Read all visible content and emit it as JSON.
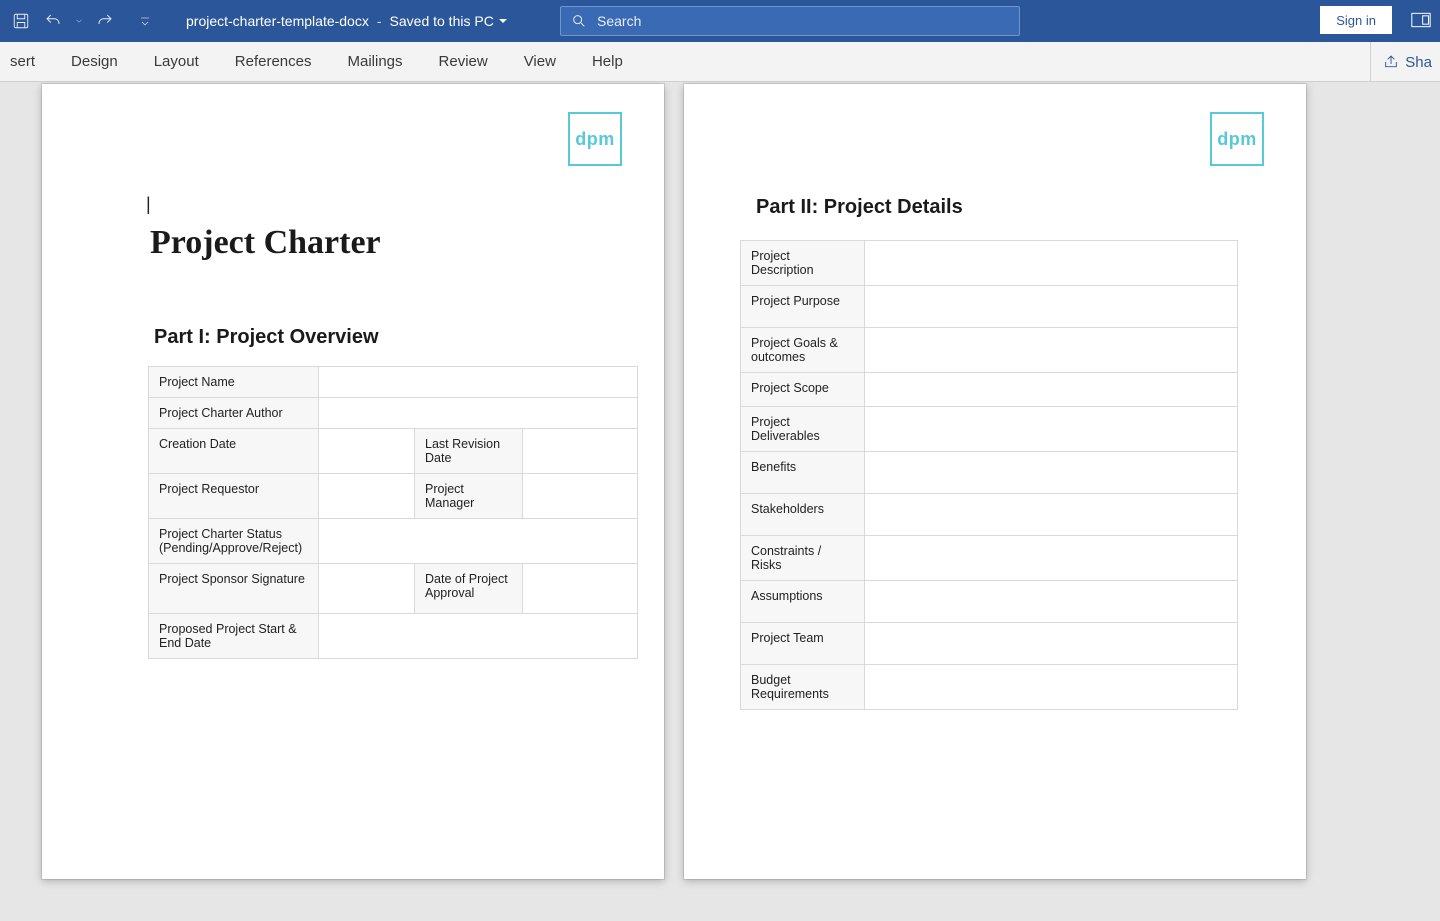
{
  "titlebar": {
    "filename": "project-charter-template-docx",
    "saved_status": "Saved to this PC",
    "search_placeholder": "Search",
    "signin_label": "Sign in"
  },
  "ribbon": {
    "tabs": [
      "sert",
      "Design",
      "Layout",
      "References",
      "Mailings",
      "Review",
      "View",
      "Help"
    ],
    "share_label": "Sha"
  },
  "logo_text": "dpm",
  "page1": {
    "doc_title": "Project Charter",
    "section_title": "Part I: Project Overview",
    "rows": {
      "project_name": "Project Name",
      "charter_author": "Project Charter Author",
      "creation_date": "Creation Date",
      "last_revision_date": "Last Revision Date",
      "project_requestor": "Project Requestor",
      "project_manager": "Project Manager",
      "charter_status": "Project Charter Status (Pending/Approve/Reject)",
      "sponsor_signature": "Project Sponsor Signature",
      "date_of_approval": "Date of Project Approval",
      "proposed_dates": "Proposed Project Start & End Date"
    }
  },
  "page2": {
    "section_title": "Part II: Project Details",
    "rows": {
      "description": "Project Description",
      "purpose": "Project Purpose",
      "goals": "Project Goals & outcomes",
      "scope": "Project Scope",
      "deliverables": "Project Deliverables",
      "benefits": "Benefits",
      "stakeholders": "Stakeholders",
      "constraints": "Constraints / Risks",
      "assumptions": "Assumptions",
      "team": "Project Team",
      "budget": "Budget Requirements"
    }
  }
}
